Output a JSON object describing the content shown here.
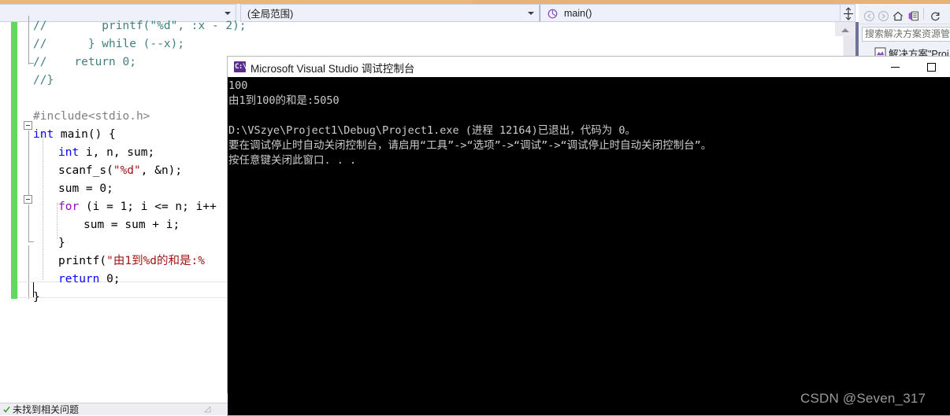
{
  "window": {
    "app": "Microsoft Visual Studio"
  },
  "navbar": {
    "file_combo": "",
    "scope_combo": "(全局范围)",
    "member_combo": "main()",
    "member_icon": "method-icon",
    "split_button": "split-window-icon"
  },
  "editor": {
    "lines": [
      {
        "indent": 0,
        "tokens": [
          {
            "t": "//        printf(\"%d\", :x - 2);",
            "c": "cm"
          }
        ]
      },
      {
        "indent": 0,
        "tokens": [
          {
            "t": "//      } while (--x);",
            "c": "cm"
          }
        ]
      },
      {
        "indent": 0,
        "tokens": [
          {
            "t": "//    return 0;",
            "c": "cm"
          }
        ]
      },
      {
        "indent": 0,
        "tokens": [
          {
            "t": "//}",
            "c": "cm"
          }
        ]
      },
      {
        "indent": 0,
        "tokens": []
      },
      {
        "indent": 0,
        "tokens": [
          {
            "t": "#include",
            "c": "pp"
          },
          {
            "t": "<stdio.h>",
            "c": "pp"
          }
        ]
      },
      {
        "indent": 0,
        "tokens": [
          {
            "t": "int",
            "c": "kw"
          },
          {
            "t": " main() {",
            "c": "fn"
          }
        ]
      },
      {
        "indent": 1,
        "tokens": [
          {
            "t": "int",
            "c": "kw"
          },
          {
            "t": " i, n, sum;",
            "c": "fn"
          }
        ]
      },
      {
        "indent": 1,
        "tokens": [
          {
            "t": "scanf_s(",
            "c": "fn"
          },
          {
            "t": "\"%d\"",
            "c": "str"
          },
          {
            "t": ", &n);",
            "c": "fn"
          }
        ]
      },
      {
        "indent": 1,
        "tokens": [
          {
            "t": "sum = 0;",
            "c": "fn"
          }
        ]
      },
      {
        "indent": 1,
        "tokens": [
          {
            "t": "for",
            "c": "kw2"
          },
          {
            "t": " (i = 1; i <= n; i++",
            "c": "fn"
          }
        ]
      },
      {
        "indent": 2,
        "tokens": [
          {
            "t": "sum = sum + i;",
            "c": "fn"
          }
        ]
      },
      {
        "indent": 1,
        "tokens": [
          {
            "t": "}",
            "c": "fn"
          }
        ]
      },
      {
        "indent": 1,
        "tokens": [
          {
            "t": "printf(",
            "c": "fn"
          },
          {
            "t": "\"由1到%d的和是:%",
            "c": "strcn"
          }
        ]
      },
      {
        "indent": 1,
        "tokens": [
          {
            "t": "return",
            "c": "kw"
          },
          {
            "t": " 0;",
            "c": "fn"
          }
        ]
      },
      {
        "indent": 0,
        "tokens": [
          {
            "t": "}",
            "c": "fn"
          }
        ]
      }
    ]
  },
  "solution_explorer": {
    "nav_back_icon": "back-arrow-icon",
    "nav_forward_icon": "forward-arrow-icon",
    "home_icon": "home-icon",
    "properties_icon": "properties-icon",
    "search_placeholder": "搜索解决方案资源管",
    "tree_node": "解决方案\"Proj"
  },
  "console": {
    "title": "Microsoft Visual Studio 调试控制台",
    "icon_text": "C:\\",
    "minimize_label": "最小化",
    "maximize_label": "最大化",
    "output_lines": [
      "100",
      "由1到100的和是:5050",
      "",
      "D:\\VSzye\\Project1\\Debug\\Project1.exe (进程 12164)已退出，代码为 0。",
      "要在调试停止时自动关闭控制台，请启用“工具”->“选项”->“调试”->“调试停止时自动关闭控制台”。",
      "按任意键关闭此窗口. . ."
    ]
  },
  "status": {
    "error_list_tab": "未找到相关问题"
  },
  "watermark": {
    "text": "CSDN @Seven_317"
  },
  "colors": {
    "change_bar": "#62d862",
    "console_bg": "#000000",
    "console_fg": "#cccccc",
    "accent": "#5c2d91",
    "navbar_bg": "#eef1fa"
  }
}
